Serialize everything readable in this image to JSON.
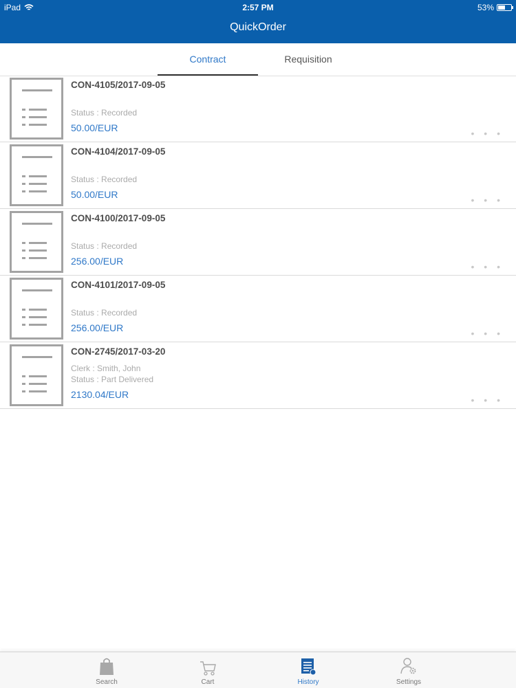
{
  "status_bar": {
    "device": "iPad",
    "time": "2:57 PM",
    "battery": "53%",
    "battery_level": 0.53
  },
  "app": {
    "title": "QuickOrder",
    "accent_color": "#0a5fac",
    "link_color": "#2f78c8"
  },
  "tabs": [
    {
      "label": "Contract",
      "active": true
    },
    {
      "label": "Requisition",
      "active": false
    }
  ],
  "orders": [
    {
      "title": "CON-4105/2017-09-05",
      "clerk": "",
      "status": "Status : Recorded",
      "amount": "50.00/EUR"
    },
    {
      "title": "CON-4104/2017-09-05",
      "clerk": "",
      "status": "Status : Recorded",
      "amount": "50.00/EUR"
    },
    {
      "title": "CON-4100/2017-09-05",
      "clerk": "",
      "status": "Status : Recorded",
      "amount": "256.00/EUR"
    },
    {
      "title": "CON-4101/2017-09-05",
      "clerk": "",
      "status": "Status : Recorded",
      "amount": "256.00/EUR"
    },
    {
      "title": "CON-2745/2017-03-20",
      "clerk": "Clerk : Smith, John",
      "status": "Status : Part Delivered",
      "amount": "2130.04/EUR"
    }
  ],
  "more_glyph": "• • •",
  "tabbar": [
    {
      "label": "Search",
      "icon": "shopping-bag-icon",
      "active": false
    },
    {
      "label": "Cart",
      "icon": "cart-icon",
      "active": false
    },
    {
      "label": "History",
      "icon": "history-icon",
      "active": true
    },
    {
      "label": "Settings",
      "icon": "user-gear-icon",
      "active": false
    }
  ]
}
